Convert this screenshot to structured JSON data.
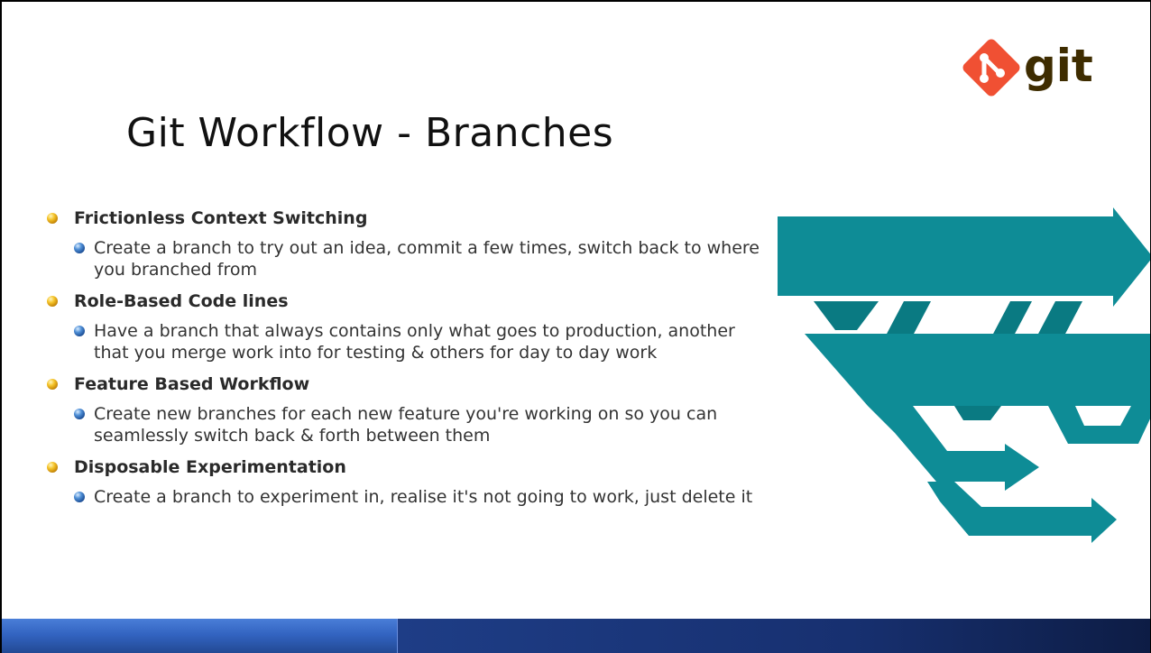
{
  "slide": {
    "title": "Git Workflow - Branches",
    "logo_text": "git",
    "bullets": [
      {
        "heading": "Frictionless Context Switching",
        "items": [
          "Create a branch to try out an idea, commit a few times, switch back to where you branched from"
        ]
      },
      {
        "heading": "Role-Based Code lines",
        "items": [
          "Have a branch that always contains only what goes to production, another that you merge work into for testing & others for day to day work"
        ]
      },
      {
        "heading": "Feature Based Workflow",
        "items": [
          "Create new branches for each new feature you're working on so you can seamlessly switch back & forth between them"
        ]
      },
      {
        "heading": "Disposable Experimentation",
        "items": [
          "Create a branch to experiment in, realise it's not going to work, just delete it"
        ]
      }
    ]
  },
  "colors": {
    "git_logo": "#f05033",
    "git_text": "#3e2c00",
    "branch_teal": "#0e8c96",
    "branch_teal_dark": "#0a7a82",
    "footer_blue": "#3263c0",
    "footer_navy": "#173070"
  },
  "icons": {
    "logo": "git-diamond-icon",
    "level1_bullet": "gold-orb-icon",
    "level2_bullet": "blue-orb-icon"
  }
}
